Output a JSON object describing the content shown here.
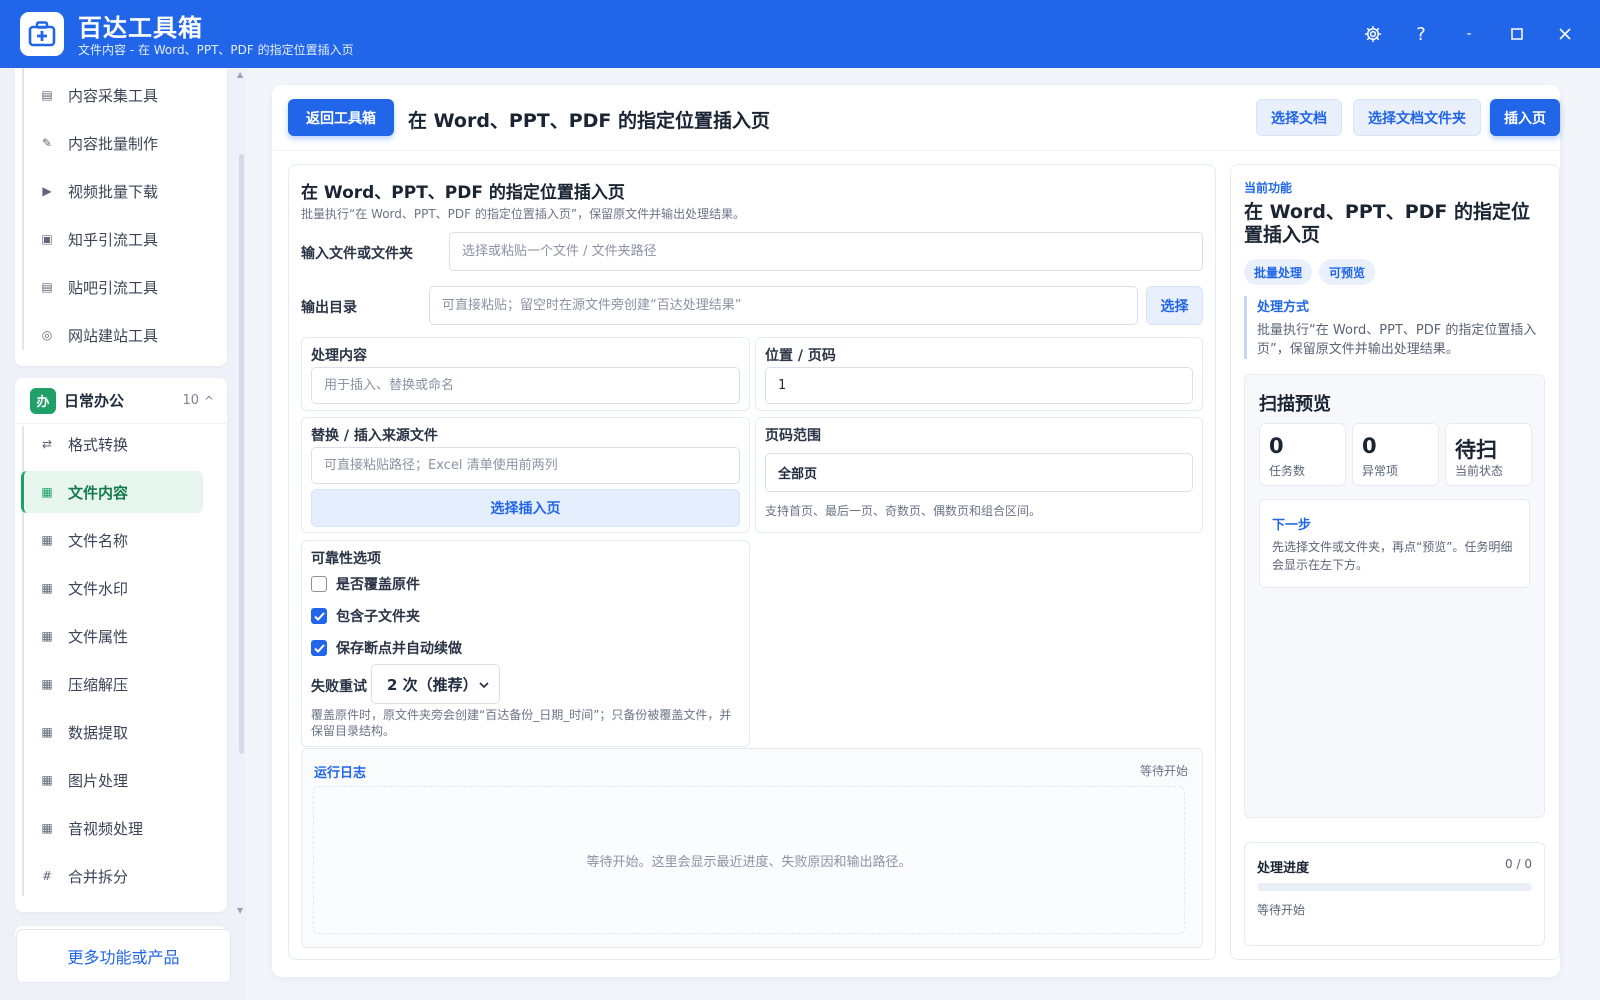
{
  "app": {
    "title": "百达工具箱",
    "subtitle": "文件内容 - 在 Word、PPT、PDF 的指定位置插入页",
    "accent": "#2166e8",
    "icons": [
      "settings-icon",
      "help-icon",
      "minimize-icon",
      "maximize-icon",
      "close-icon"
    ]
  },
  "window_controls": {
    "help": "?",
    "minimize": "-"
  },
  "sidebar": {
    "top_items": [
      {
        "label": "内容采集工具",
        "icon": "collect-icon"
      },
      {
        "label": "内容批量制作",
        "icon": "pen-icon"
      },
      {
        "label": "视频批量下载",
        "icon": "video-icon"
      },
      {
        "label": "知乎引流工具",
        "icon": "zhihu-icon"
      },
      {
        "label": "贴吧引流工具",
        "icon": "tieba-icon"
      },
      {
        "label": "网站建站工具",
        "icon": "globe-icon"
      }
    ],
    "group": {
      "badge": "办",
      "name": "日常办公",
      "count": "10",
      "caret": "^",
      "color": "#1ea067"
    },
    "group_items": [
      {
        "label": "格式转换",
        "icon": "swap-icon",
        "glyph": "⇄",
        "active": false
      },
      {
        "label": "文件内容",
        "icon": "grid-icon",
        "glyph": "▦",
        "active": true
      },
      {
        "label": "文件名称",
        "icon": "grid-icon",
        "glyph": "▦",
        "active": false
      },
      {
        "label": "文件水印",
        "icon": "grid-icon",
        "glyph": "▦",
        "active": false
      },
      {
        "label": "文件属性",
        "icon": "grid-icon",
        "glyph": "▦",
        "active": false
      },
      {
        "label": "压缩解压",
        "icon": "grid-icon",
        "glyph": "▦",
        "active": false
      },
      {
        "label": "数据提取",
        "icon": "grid-icon",
        "glyph": "▦",
        "active": false
      },
      {
        "label": "图片处理",
        "icon": "grid-icon",
        "glyph": "▦",
        "active": false
      },
      {
        "label": "音视频处理",
        "icon": "grid-icon",
        "glyph": "▦",
        "active": false
      },
      {
        "label": "合并拆分",
        "icon": "hash-icon",
        "glyph": "#",
        "active": false
      }
    ],
    "more_label": "更多功能或产品"
  },
  "header": {
    "back_label": "返回工具箱",
    "title": "在 Word、PPT、PDF 的指定位置插入页",
    "select_doc_label": "选择文档",
    "select_folder_label": "选择文档文件夹",
    "insert_label": "插入页"
  },
  "form": {
    "title": "在 Word、PPT、PDF 的指定位置插入页",
    "desc": "批量执行“在 Word、PPT、PDF 的指定位置插入页”，保留原文件并输出处理结果。",
    "input_label": "输入文件或文件夹",
    "input_placeholder": "选择或粘贴一个文件 / 文件夹路径",
    "output_label": "输出目录",
    "output_placeholder": "可直接粘贴；留空时在源文件旁创建“百达处理结果”",
    "output_select_label": "选择",
    "content_label": "处理内容",
    "content_placeholder": "用于插入、替换或命名",
    "position_label": "位置 / 页码",
    "position_value": "1",
    "source_label": "替换 / 插入来源文件",
    "source_placeholder": "可直接粘贴路径；Excel 清单使用前两列",
    "source_button": "选择插入页",
    "range_label": "页码范围",
    "range_value": "全部页",
    "range_hint": "支持首页、最后一页、奇数页、偶数页和组合区间。",
    "reliability_label": "可靠性选项",
    "options": [
      {
        "label": "是否覆盖原件",
        "checked": false
      },
      {
        "label": "包含子文件夹",
        "checked": true
      },
      {
        "label": "保存断点并自动续做",
        "checked": true
      }
    ],
    "retry_label": "失败重试",
    "retry_value": "2 次（推荐）",
    "reliability_hint": "覆盖原件时，原文件夹旁会创建“百达备份_日期_时间”；只备份被覆盖文件，并保留目录结构。"
  },
  "log": {
    "title": "运行日志",
    "status": "等待开始",
    "empty_text": "等待开始。这里会显示最近进度、失败原因和输出路径。"
  },
  "right": {
    "eyebrow": "当前功能",
    "title": "在 Word、PPT、PDF 的指定位置插入页",
    "tags": [
      "批量处理",
      "可预览"
    ],
    "method_title": "处理方式",
    "method_text": "批量执行“在 Word、PPT、PDF 的指定位置插入页”，保留原文件并输出处理结果。",
    "scan_title": "扫描预览",
    "stats": [
      {
        "value": "0",
        "label": "任务数"
      },
      {
        "value": "0",
        "label": "异常项"
      },
      {
        "value": "待扫",
        "label": "当前状态"
      }
    ],
    "next_title": "下一步",
    "next_text": "先选择文件或文件夹，再点“预览”。任务明细会显示在左下方。",
    "progress_title": "处理进度",
    "progress_count": "0 / 0",
    "progress_fraction": 0,
    "progress_status": "等待开始"
  }
}
